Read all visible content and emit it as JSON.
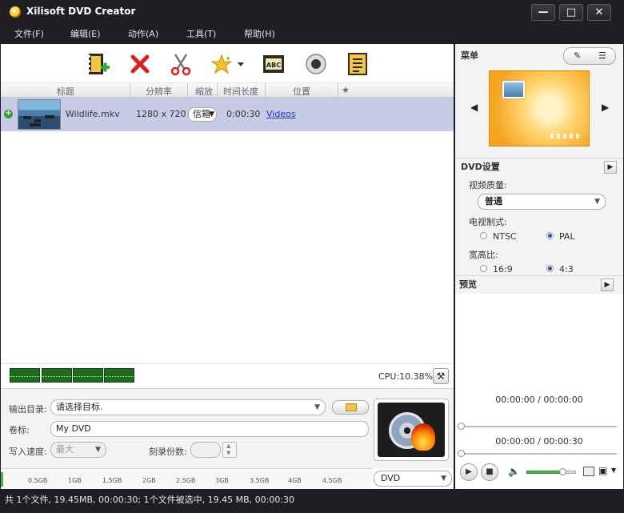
{
  "window": {
    "title": "Xilisoft DVD Creator",
    "minimize_icon": "minimize-icon",
    "maximize_icon": "maximize-icon",
    "close_icon": "close-icon"
  },
  "menu": {
    "items": [
      {
        "label": "文件(F)"
      },
      {
        "label": "编辑(E)"
      },
      {
        "label": "动作(A)"
      },
      {
        "label": "工具(T)"
      },
      {
        "label": "帮助(H)"
      }
    ]
  },
  "toolbar": {
    "icons": [
      "add-file-icon",
      "delete-icon",
      "clip-icon",
      "effects-icon",
      "subtitle-icon",
      "record-icon",
      "properties-icon"
    ],
    "subtitle_glyph": "ABC"
  },
  "file_list": {
    "columns": [
      "标题",
      "分辨率",
      "缩放",
      "时间长度",
      "位置",
      "★"
    ],
    "rows": [
      {
        "title": "Wildlife.mkv",
        "resolution": "1280 x 720",
        "zoom": "信箱",
        "duration": "0:00:30",
        "location": "Videos"
      }
    ]
  },
  "cpu": {
    "label": "CPU:10.38%"
  },
  "output": {
    "dir_label": "输出目录:",
    "dir_value": "请选择目标.",
    "volume_label": "卷标:",
    "volume_value": "My DVD",
    "speed_label": "写入速度:",
    "speed_value": "最大",
    "copies_label": "刻录份数:"
  },
  "capacity": {
    "ticks": [
      "0.5GB",
      "1GB",
      "1.5GB",
      "2GB",
      "2.5GB",
      "3GB",
      "3.5GB",
      "4GB",
      "4.5GB"
    ],
    "disc_type": "DVD",
    "used_fraction": 0.0043
  },
  "menu_panel": {
    "title": "菜单"
  },
  "dvd_settings": {
    "title": "DVD设置",
    "quality_label": "视频质量:",
    "quality_value": "普通",
    "tv_label": "电视制式:",
    "ntsc": "NTSC",
    "pal": "PAL",
    "tv_selected": "PAL",
    "aspect_label": "宽高比:",
    "aspect_169": "16:9",
    "aspect_43": "4:3",
    "aspect_selected": "4:3"
  },
  "preview": {
    "title": "预览",
    "time_current": "00:00:00 / 00:00:00",
    "time_total": "00:00:00 / 00:00:30"
  },
  "status": {
    "text": "共 1个文件, 19.45MB,  00:00:30; 1个文件被选中, 19.45 MB,  00:00:30"
  }
}
